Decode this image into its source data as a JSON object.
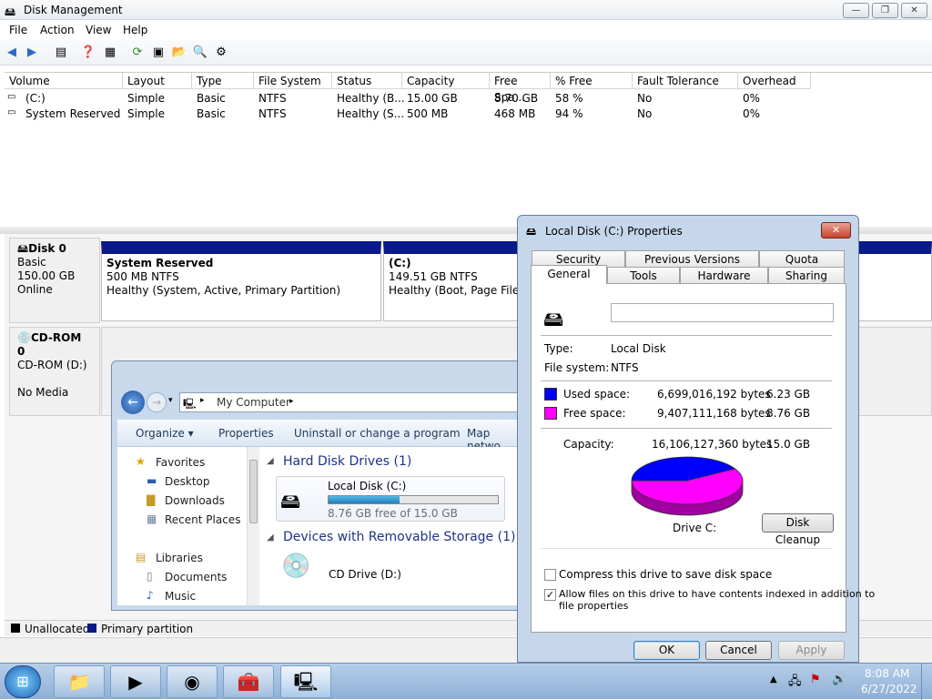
{
  "window": {
    "title": "Disk Management"
  },
  "menu": [
    "File",
    "Action",
    "View",
    "Help"
  ],
  "volume_table": {
    "columns": [
      "Volume",
      "Layout",
      "Type",
      "File System",
      "Status",
      "Capacity",
      "Free Spa...",
      "% Free",
      "Fault Tolerance",
      "Overhead"
    ],
    "rows": [
      [
        "(C:)",
        "Simple",
        "Basic",
        "NTFS",
        "Healthy (B...",
        "15.00 GB",
        "8.70 GB",
        "58 %",
        "No",
        "0%"
      ],
      [
        "System Reserved",
        "Simple",
        "Basic",
        "NTFS",
        "Healthy (S...",
        "500 MB",
        "468 MB",
        "94 %",
        "No",
        "0%"
      ]
    ]
  },
  "disks": [
    {
      "name": "Disk 0",
      "type": "Basic",
      "size": "150.00 GB",
      "state": "Online"
    },
    {
      "name": "CD-ROM 0",
      "type": "CD-ROM (D:)",
      "state": "No Media"
    }
  ],
  "partitions": [
    {
      "name": "System Reserved",
      "size": "500 MB NTFS",
      "status": "Healthy (System, Active, Primary Partition)"
    },
    {
      "name": "(C:)",
      "size": "149.51 GB NTFS",
      "status": "Healthy (Boot, Page File, C"
    }
  ],
  "legend": {
    "unallocated": "Unallocated",
    "primary": "Primary partition",
    "unallocated_color": "#000000",
    "primary_color": "#0a1a8a"
  },
  "explorer": {
    "breadcrumb": "My Computer",
    "commands": [
      "Organize ▾",
      "Properties",
      "Uninstall or change a program",
      "Map netwo"
    ],
    "nav": {
      "favorites": "Favorites",
      "desktop": "Desktop",
      "downloads": "Downloads",
      "recent": "Recent Places",
      "libraries": "Libraries",
      "documents": "Documents",
      "music": "Music"
    },
    "groups": {
      "hdd": "Hard Disk Drives (1)",
      "removable": "Devices with Removable Storage (1)"
    },
    "local_disk": {
      "name": "Local Disk (C:)",
      "free_text": "8.76 GB free of 15.0 GB",
      "used_fraction": 0.42
    },
    "cd_drive": "CD Drive (D:)"
  },
  "dialog": {
    "title": "Local Disk (C:) Properties",
    "close": "✕",
    "tabs_back": [
      "Security",
      "Previous Versions",
      "Quota"
    ],
    "tabs_front": [
      "General",
      "Tools",
      "Hardware",
      "Sharing"
    ],
    "name_value": "",
    "type_label": "Type:",
    "type_value": "Local Disk",
    "fs_label": "File system:",
    "fs_value": "NTFS",
    "used_label": "Used space:",
    "used_bytes": "6,699,016,192 bytes",
    "used_gb": "6.23 GB",
    "free_label": "Free space:",
    "free_bytes": "9,407,111,168 bytes",
    "free_gb": "8.76 GB",
    "cap_label": "Capacity:",
    "cap_bytes": "16,106,127,360 bytes",
    "cap_gb": "15.0 GB",
    "drive_label": "Drive C:",
    "cleanup": "Disk Cleanup",
    "compress": "Compress this drive to save disk space",
    "index_line1": "Allow files on this drive to have contents indexed in addition to",
    "index_line2": "file properties",
    "ok": "OK",
    "cancel": "Cancel",
    "apply": "Apply",
    "used_color": "#0000ff",
    "free_color": "#ff00ff"
  },
  "taskbar": {
    "time": "8:08 AM",
    "date": "6/27/2022"
  }
}
